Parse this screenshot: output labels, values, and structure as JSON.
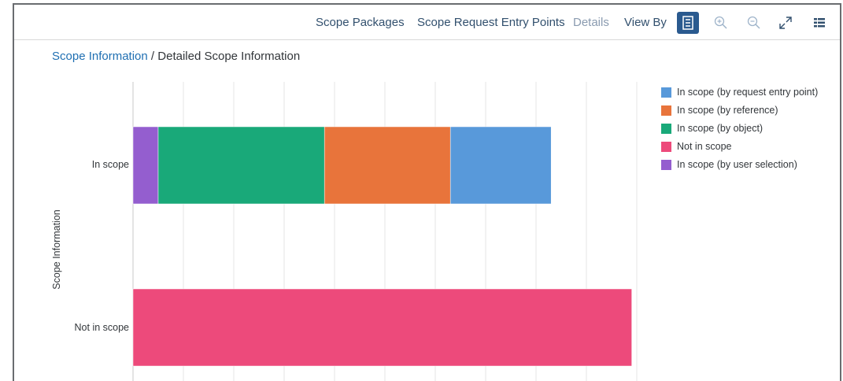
{
  "toolbar": {
    "links": [
      "Scope Packages",
      "Scope Request Entry Points",
      "Details",
      "View By"
    ],
    "icons": [
      "table-view-icon",
      "zoom-in-icon",
      "zoom-out-icon",
      "fullscreen-icon",
      "legend-list-icon"
    ]
  },
  "breadcrumb": {
    "link": "Scope Information",
    "separator": " / ",
    "current": "Detailed Scope Information"
  },
  "colors": {
    "request_entry_point": "#5899da",
    "reference": "#e8743b",
    "object": "#19a979",
    "not_in_scope": "#ed4a7b",
    "user_selection": "#945ecf",
    "accent": "#2a5a8f",
    "gridline": "#e5e5e5"
  },
  "chart_data": {
    "type": "bar",
    "orientation": "horizontal",
    "stacked": true,
    "categories": [
      "In scope",
      "Not in scope"
    ],
    "series": [
      {
        "name": "In scope (by user selection)",
        "values": [
          5,
          0
        ]
      },
      {
        "name": "In scope (by object)",
        "values": [
          33,
          0
        ]
      },
      {
        "name": "In scope (by reference)",
        "values": [
          25,
          0
        ]
      },
      {
        "name": "In scope (by request entry point)",
        "values": [
          20,
          0
        ]
      },
      {
        "name": "Not in scope",
        "values": [
          0,
          99
        ]
      }
    ],
    "legend_order": [
      "In scope (by request entry point)",
      "In scope (by reference)",
      "In scope (by object)",
      "Not in scope",
      "In scope (by user selection)"
    ],
    "xlim": [
      0,
      100
    ],
    "ylabel": "Scope Information",
    "grid": true,
    "legend_position": "right"
  }
}
